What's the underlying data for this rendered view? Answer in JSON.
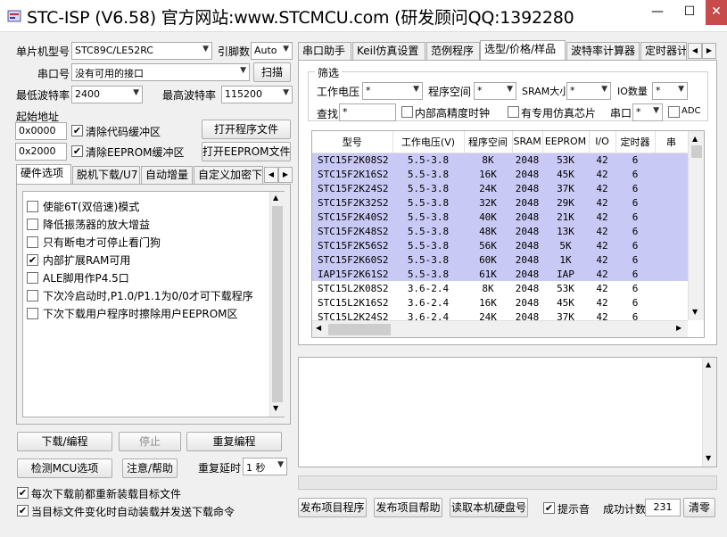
{
  "window": {
    "title": "STC-ISP (V6.58) 官方网站:www.STCMCU.com  (研发顾问QQ:1392280",
    "minimize": "—",
    "maximize": "☐",
    "close": "✕"
  },
  "left": {
    "mcu_label": "单片机型号",
    "mcu_value": "STC89C/LE52RC",
    "pins_label": "引脚数",
    "pins_value": "Auto",
    "port_label": "串口号",
    "port_value": "没有可用的接口",
    "scan_button": "扫描",
    "min_baud_label": "最低波特率",
    "min_baud_value": "2400",
    "max_baud_label": "最高波特率",
    "max_baud_value": "115200",
    "start_addr_label": "起始地址",
    "addr1_value": "0x0000",
    "clear_code_label": "清除代码缓冲区",
    "addr2_value": "0x2000",
    "clear_eeprom_label": "清除EEPROM缓冲区",
    "open_program_button": "打开程序文件",
    "open_eeprom_button": "打开EEPROM文件",
    "tabs": [
      "硬件选项",
      "脱机下载/U7",
      "自动增量",
      "自定义加密下"
    ],
    "options": [
      {
        "label": "使能6T(双倍速)模式",
        "checked": false
      },
      {
        "label": "降低振荡器的放大增益",
        "checked": false
      },
      {
        "label": "只有断电才可停止看门狗",
        "checked": false
      },
      {
        "label": "内部扩展RAM可用",
        "checked": true
      },
      {
        "label": "ALE脚用作P4.5口",
        "checked": false
      },
      {
        "label": "下次冷启动时,P1.0/P1.1为0/0才可下载程序",
        "checked": false
      },
      {
        "label": "下次下载用户程序时擦除用户EEPROM区",
        "checked": false
      }
    ],
    "download_button": "下载/编程",
    "stop_button": "停止",
    "repeat_button": "重复编程",
    "detect_button": "检测MCU选项",
    "help_button": "注意/帮助",
    "repeat_delay_label": "重复延时",
    "repeat_delay_value": "1 秒",
    "reload_label": "每次下载前都重新装载目标文件",
    "auto_load_label": "当目标文件变化时自动装载并发送下载命令"
  },
  "right": {
    "tabs": [
      "串口助手",
      "Keil仿真设置",
      "范例程序",
      "选型/价格/样品",
      "波特率计算器",
      "定时器计"
    ],
    "filter_title": "筛选",
    "voltage_label": "工作电压",
    "voltage_value": "*",
    "program_space_label": "程序空间",
    "program_space_value": "*",
    "sram_label": "SRAM大小",
    "sram_value": "*",
    "io_label": "IO数量",
    "io_value": "*",
    "search_label": "查找",
    "search_value": "*",
    "hp_clock_label": "内部高精度时钟",
    "emu_chip_label": "有专用仿真芯片",
    "uart_label": "串口",
    "uart_value": "*",
    "adc_label": "ADC",
    "columns": [
      "型号",
      "工作电压(V)",
      "程序空间",
      "SRAM",
      "EEPROM",
      "I/O",
      "定时器",
      "串"
    ],
    "rows": [
      [
        "STC15F2K08S2",
        "5.5-3.8",
        "8K",
        "2048",
        "53K",
        "42",
        "6"
      ],
      [
        "STC15F2K16S2",
        "5.5-3.8",
        "16K",
        "2048",
        "45K",
        "42",
        "6"
      ],
      [
        "STC15F2K24S2",
        "5.5-3.8",
        "24K",
        "2048",
        "37K",
        "42",
        "6"
      ],
      [
        "STC15F2K32S2",
        "5.5-3.8",
        "32K",
        "2048",
        "29K",
        "42",
        "6"
      ],
      [
        "STC15F2K40S2",
        "5.5-3.8",
        "40K",
        "2048",
        "21K",
        "42",
        "6"
      ],
      [
        "STC15F2K48S2",
        "5.5-3.8",
        "48K",
        "2048",
        "13K",
        "42",
        "6"
      ],
      [
        "STC15F2K56S2",
        "5.5-3.8",
        "56K",
        "2048",
        "5K",
        "42",
        "6"
      ],
      [
        "STC15F2K60S2",
        "5.5-3.8",
        "60K",
        "2048",
        "1K",
        "42",
        "6"
      ],
      [
        "IAP15F2K61S2",
        "5.5-3.8",
        "61K",
        "2048",
        "IAP",
        "42",
        "6"
      ],
      [
        "STC15L2K08S2",
        "3.6-2.4",
        "8K",
        "2048",
        "53K",
        "42",
        "6"
      ],
      [
        "STC15L2K16S2",
        "3.6-2.4",
        "16K",
        "2048",
        "45K",
        "42",
        "6"
      ],
      [
        "STC15L2K24S2",
        "3.6-2.4",
        "24K",
        "2048",
        "37K",
        "42",
        "6"
      ]
    ],
    "highlighted_rows": 9,
    "publish_program_button": "发布项目程序",
    "publish_help_button": "发布项目帮助",
    "read_serial_button": "读取本机硬盘号",
    "prompt_sound_label": "提示音",
    "success_count_label": "成功计数",
    "success_count_value": "231",
    "clear_button": "清零"
  },
  "colors": {
    "highlight_row": "#c9c9f5",
    "background": "#f0f0f0",
    "close_button": "#c74b4b"
  }
}
